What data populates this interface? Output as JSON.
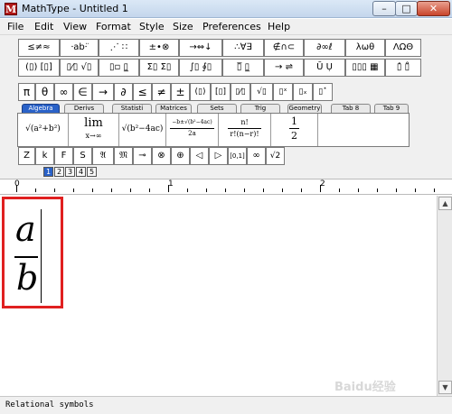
{
  "window": {
    "title": "MathType - Untitled 1",
    "app_icon": "mathtype-icon",
    "min_label": "–",
    "max_label": "□",
    "close_label": "✕"
  },
  "menu": [
    "File",
    "Edit",
    "View",
    "Format",
    "Style",
    "Size",
    "Preferences",
    "Help"
  ],
  "toolbar": {
    "row1": [
      "≤≠≈",
      "⸱ab⸱̈",
      "⋰ ∷",
      "±•⊗",
      "→⇔↓",
      "∴∀∃",
      "∉∩⊂",
      "∂∞ℓ",
      "λωθ",
      "ΛΩΘ"
    ],
    "row2": [
      "(▯) [▯]",
      "▯⁄▯ √▯",
      "▯▫ ▯̲",
      "Σ▯ Σ▯",
      "∫▯ ∮▯",
      "▯̅ ▯̲",
      "→ ⇌",
      "Ū Ụ",
      "▯▯▯ ▦",
      "▯̂ ▯̊"
    ],
    "row3": [
      "π",
      "θ",
      "∞",
      "∈",
      "→",
      "∂",
      "≤",
      "≠",
      "±",
      "(▯)",
      "[▯]",
      "▯⁄▯",
      "√▯",
      "▯ˣ",
      "▯ₓ",
      "▯˟"
    ],
    "row5": [
      "Z",
      "k",
      "F",
      "S",
      "𝔄",
      "𝔐",
      "⊸",
      "⊗",
      "⊕",
      "◁",
      "▷",
      "[0,1]",
      "∞",
      "√2"
    ]
  },
  "tabs": [
    "Algebra",
    "Derivs",
    "Statisti",
    "Matrices",
    "Sets",
    "Trig",
    "Geometry",
    "Tab 8",
    "Tab 9"
  ],
  "templates": {
    "t1": "√(a²+b²)",
    "t2_top": "lim",
    "t2_bottom": "x→∞",
    "t3": "√(b²−4ac)",
    "t4_top": "−b±√(b²−4ac)",
    "t4_bottom": "2a",
    "t5_top": "n!",
    "t5_bottom": "r!(n−r)!",
    "t6_top": "1",
    "t6_bottom": "2"
  },
  "size_tabs": [
    "1",
    "2",
    "3",
    "4",
    "5"
  ],
  "ruler": {
    "labels": [
      "0",
      "1",
      "2"
    ]
  },
  "equation": {
    "numerator": "a",
    "denominator": "b"
  },
  "status": "Relational symbols",
  "watermark": "Baidu经验"
}
